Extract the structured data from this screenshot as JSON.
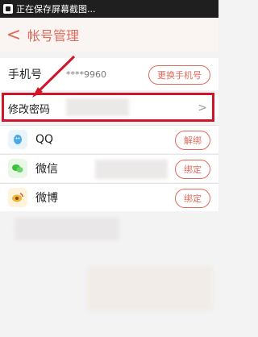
{
  "statusbar": {
    "text": "正在保存屏幕截图..."
  },
  "header": {
    "back_symbol": "<",
    "title": "帐号管理"
  },
  "phone": {
    "label": "手机号",
    "masked_value": "****9960",
    "change_button": "更换手机号"
  },
  "password": {
    "label": "修改密码",
    "chevron": ">"
  },
  "social": [
    {
      "name": "QQ",
      "action": "解绑"
    },
    {
      "name": "微信",
      "action": "绑定"
    },
    {
      "name": "微博",
      "action": "绑定"
    }
  ],
  "colors": {
    "accent": "#e06a5a",
    "highlight": "#d0152b",
    "arrow": "#d0152b"
  },
  "icons": {
    "back": "chevron-left-icon",
    "qq": "qq-icon",
    "wechat": "wechat-icon",
    "weibo": "weibo-icon",
    "status": "screenshot-icon"
  }
}
